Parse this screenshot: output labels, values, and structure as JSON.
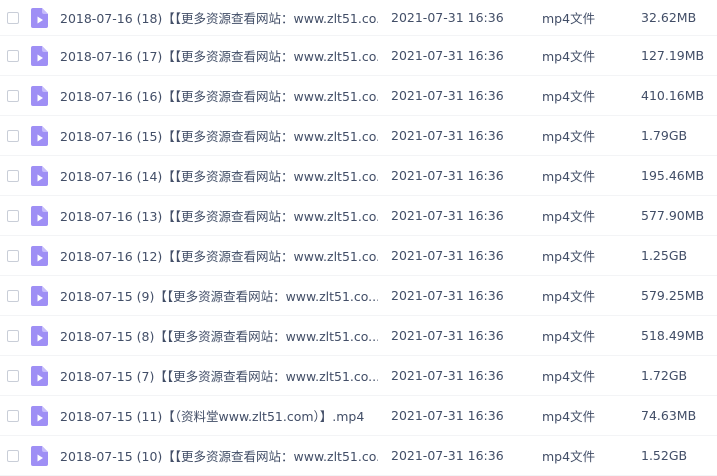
{
  "colors": {
    "text": "#424e67",
    "icon": "#9f8ff5",
    "icon_play": "#ffffff"
  },
  "file_icon": "video-file-icon",
  "files": [
    {
      "name": "2018-07-16 (18)【【更多资源查看网站：www.zlt51.co...",
      "date": "2021-07-31 16:36",
      "type": "mp4文件",
      "size": "32.62MB"
    },
    {
      "name": "2018-07-16 (17)【【更多资源查看网站：www.zlt51.co...",
      "date": "2021-07-31 16:36",
      "type": "mp4文件",
      "size": "127.19MB"
    },
    {
      "name": "2018-07-16 (16)【【更多资源查看网站：www.zlt51.co...",
      "date": "2021-07-31 16:36",
      "type": "mp4文件",
      "size": "410.16MB"
    },
    {
      "name": "2018-07-16 (15)【【更多资源查看网站：www.zlt51.co...",
      "date": "2021-07-31 16:36",
      "type": "mp4文件",
      "size": "1.79GB"
    },
    {
      "name": "2018-07-16 (14)【【更多资源查看网站：www.zlt51.co...",
      "date": "2021-07-31 16:36",
      "type": "mp4文件",
      "size": "195.46MB"
    },
    {
      "name": "2018-07-16 (13)【【更多资源查看网站：www.zlt51.co...",
      "date": "2021-07-31 16:36",
      "type": "mp4文件",
      "size": "577.90MB"
    },
    {
      "name": "2018-07-16 (12)【【更多资源查看网站：www.zlt51.co...",
      "date": "2021-07-31 16:36",
      "type": "mp4文件",
      "size": "1.25GB"
    },
    {
      "name": "2018-07-15 (9)【【更多资源查看网站：www.zlt51.co...",
      "date": "2021-07-31 16:36",
      "type": "mp4文件",
      "size": "579.25MB"
    },
    {
      "name": "2018-07-15 (8)【【更多资源查看网站：www.zlt51.co...",
      "date": "2021-07-31 16:36",
      "type": "mp4文件",
      "size": "518.49MB"
    },
    {
      "name": "2018-07-15 (7)【【更多资源查看网站：www.zlt51.co...",
      "date": "2021-07-31 16:36",
      "type": "mp4文件",
      "size": "1.72GB"
    },
    {
      "name": "2018-07-15 (11)【（资料堂www.zlt51.com）】.mp4",
      "date": "2021-07-31 16:36",
      "type": "mp4文件",
      "size": "74.63MB"
    },
    {
      "name": "2018-07-15 (10)【【更多资源查看网站：www.zlt51.co...",
      "date": "2021-07-31 16:36",
      "type": "mp4文件",
      "size": "1.52GB"
    }
  ]
}
